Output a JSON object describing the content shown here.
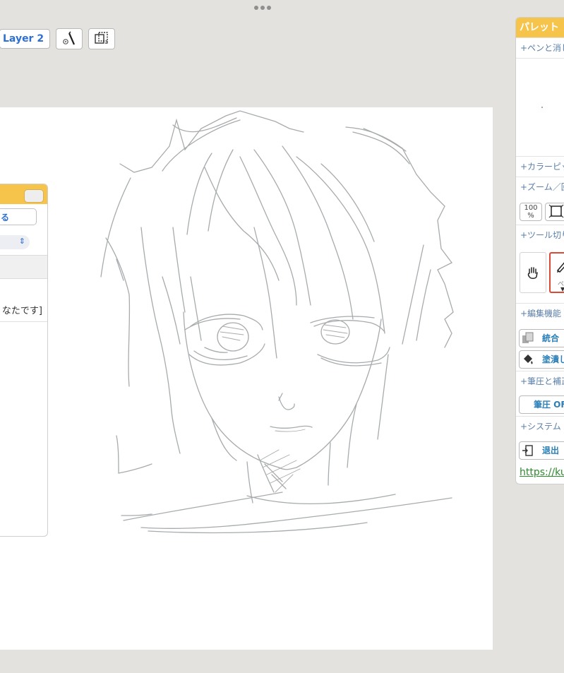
{
  "toolbar": {
    "layer_label": "Layer 2",
    "pen_settings_icon": "pen-gear-icon",
    "transform_icon": "transform-icon"
  },
  "dialog": {
    "row1_text": "る",
    "select_icon": "chevron-updown-icon",
    "text_line": "なたです]"
  },
  "palette": {
    "title": "パレット",
    "sections": {
      "pen_eraser": "+ペンと消し",
      "color_picker": "+カラーピッ",
      "zoom_rotate": "+ズーム／回",
      "tool_switch": "+ツール切り",
      "edit_functions": "+編集機能",
      "pressure_correction": "+筆圧と補正",
      "system": "+システム"
    },
    "zoom_100_label_top": "100",
    "zoom_100_label_bottom": "%",
    "pen_tool_label": "ペン",
    "merge_button": "統合",
    "fill_button": "塗潰し",
    "pressure_button": "筆圧 OF",
    "exit_button": "退出",
    "link_text": "https://ku"
  },
  "colors": {
    "accent_yellow": "#f6c44a",
    "link_blue": "#2d6fd2",
    "section_text": "#5a7ea6",
    "active_tool_border": "#d94a36",
    "link_green": "#2d8a2d"
  }
}
